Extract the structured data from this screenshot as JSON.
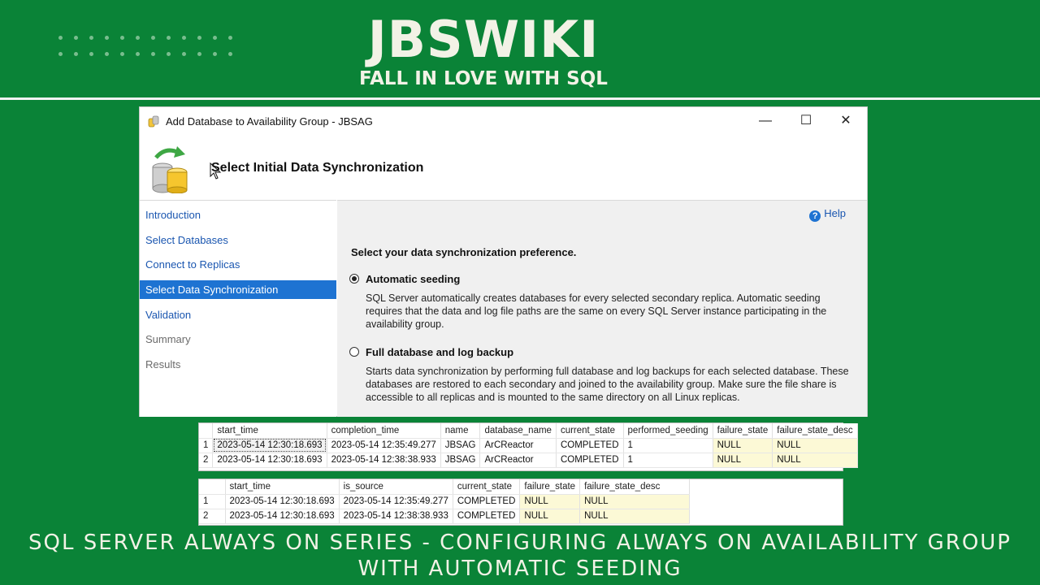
{
  "brand": {
    "title": "JBSWIKI",
    "tagline": "FALL IN LOVE WITH SQL"
  },
  "window": {
    "title": "Add Database to Availability Group - JBSAG",
    "minimize_glyph": "—",
    "maximize_glyph": "☐",
    "close_glyph": "✕",
    "heading": "Select Initial Data Synchronization"
  },
  "nav": {
    "items": [
      {
        "label": "Introduction",
        "state": "link"
      },
      {
        "label": "Select Databases",
        "state": "link"
      },
      {
        "label": "Connect to Replicas",
        "state": "link"
      },
      {
        "label": "Select Data Synchronization",
        "state": "active"
      },
      {
        "label": "Validation",
        "state": "link"
      },
      {
        "label": "Summary",
        "state": "disabled"
      },
      {
        "label": "Results",
        "state": "disabled"
      }
    ]
  },
  "content": {
    "help_label": "Help",
    "prompt": "Select your data synchronization preference.",
    "options": [
      {
        "label": "Automatic seeding",
        "selected": true,
        "description": "SQL Server automatically creates databases for every selected secondary replica. Automatic seeding requires that the data and log file paths are the same on every SQL Server instance participating in the availability group."
      },
      {
        "label": "Full database and log backup",
        "selected": false,
        "description": "Starts data synchronization by performing full database and log backups for each selected database. These databases are restored to each secondary and joined to the availability group. Make sure the file share is accessible to all replicas and is mounted to the same directory on all Linux replicas."
      }
    ]
  },
  "grid1": {
    "columns": [
      "start_time",
      "completion_time",
      "name",
      "database_name",
      "current_state",
      "performed_seeding",
      "failure_state",
      "failure_state_desc"
    ],
    "rows": [
      {
        "num": "1",
        "cells": [
          "2023-05-14 12:30:18.693",
          "2023-05-14 12:35:49.277",
          "JBSAG",
          "ArCReactor",
          "COMPLETED",
          "1",
          "NULL",
          "NULL"
        ]
      },
      {
        "num": "2",
        "cells": [
          "2023-05-14 12:30:18.693",
          "2023-05-14 12:38:38.933",
          "JBSAG",
          "ArCReactor",
          "COMPLETED",
          "1",
          "NULL",
          "NULL"
        ]
      }
    ]
  },
  "grid2": {
    "columns": [
      "start_time",
      "is_source",
      "current_state",
      "failure_state",
      "failure_state_desc"
    ],
    "rows": [
      {
        "num": "1",
        "cells": [
          "2023-05-14 12:30:18.693",
          "2023-05-14 12:35:49.277",
          "COMPLETED",
          "NULL",
          "NULL"
        ]
      },
      {
        "num": "2",
        "cells": [
          "2023-05-14 12:30:18.693",
          "2023-05-14 12:38:38.933",
          "COMPLETED",
          "NULL",
          "NULL"
        ]
      }
    ]
  },
  "footer": {
    "title_line1": "SQL SERVER ALWAYS ON SERIES - CONFIGURING ALWAYS ON AVAILABILITY GROUP",
    "title_line2": "WITH AUTOMATIC SEEDING"
  },
  "colors": {
    "background": "#0a8337",
    "nav_active": "#1e73d2",
    "link": "#1a56b0",
    "null_cell": "#fcf9d6"
  }
}
